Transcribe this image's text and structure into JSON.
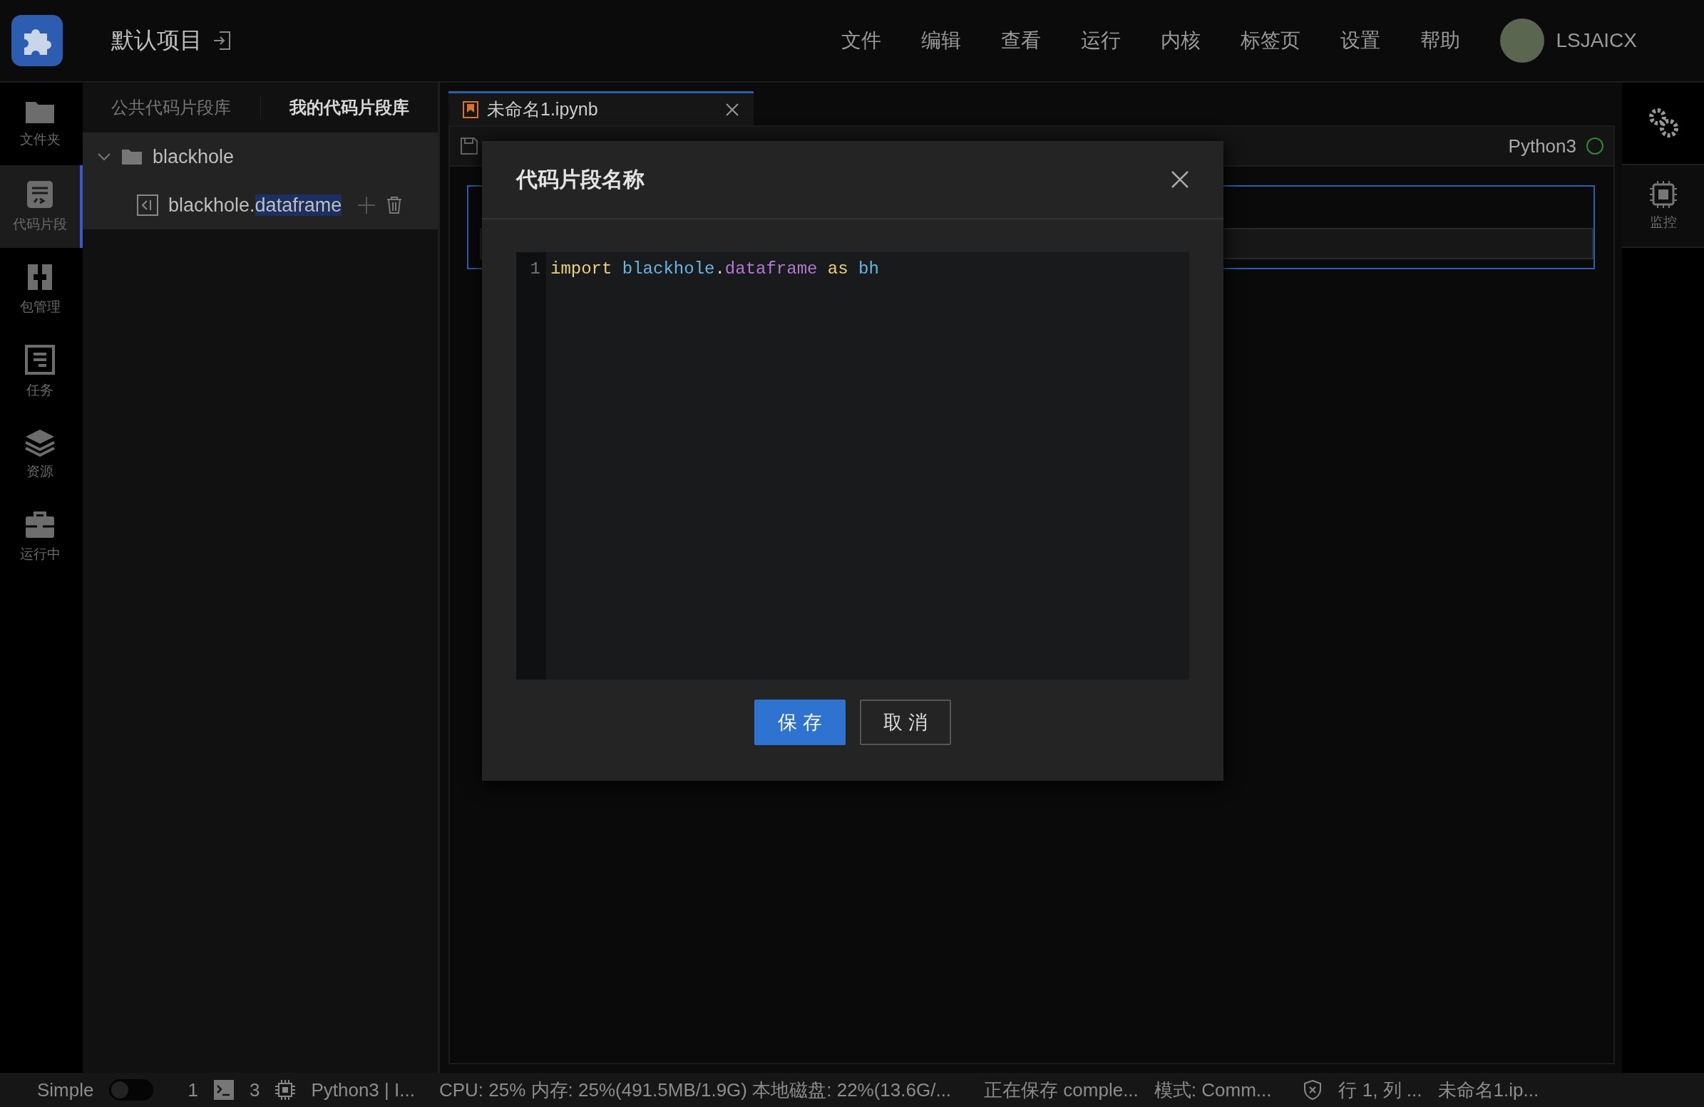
{
  "header": {
    "project": "默认项目",
    "menu": [
      "文件",
      "编辑",
      "查看",
      "运行",
      "内核",
      "标签页",
      "设置",
      "帮助"
    ],
    "user": "LSJAICX"
  },
  "sidebar": {
    "items": [
      {
        "label": "文件夹",
        "kind": "folder",
        "selected": false
      },
      {
        "label": "代码片段",
        "kind": "snippet",
        "selected": true
      },
      {
        "label": "包管理",
        "kind": "package",
        "selected": false
      },
      {
        "label": "任务",
        "kind": "task",
        "selected": false
      },
      {
        "label": "资源",
        "kind": "layers",
        "selected": false
      },
      {
        "label": "运行中",
        "kind": "briefcase",
        "selected": false
      }
    ]
  },
  "snippet_panel": {
    "tabs": [
      {
        "label": "公共代码片段库",
        "selected": false
      },
      {
        "label": "我的代码片段库",
        "selected": true
      }
    ],
    "tree": [
      {
        "label": "blackhole",
        "expanded": true,
        "children": [
          {
            "parts": [
              {
                "text": "blackhole.",
                "highlighted": false
              },
              {
                "text": "dataframe",
                "highlighted": true
              }
            ]
          }
        ]
      }
    ]
  },
  "editor": {
    "tabs": [
      {
        "label": "未命名1.ipynb",
        "selected": true
      }
    ],
    "kernel": "Python3"
  },
  "right_rail": {
    "items": [
      {
        "kind": "settings"
      },
      {
        "label": "监控",
        "kind": "monitor"
      }
    ]
  },
  "dialog": {
    "title": "代码片段名称",
    "line_number": "1",
    "code_words": [
      [
        {
          "text": "import",
          "kind": "keyword"
        }
      ],
      [
        {
          "text": "blackhole",
          "kind": "name"
        },
        {
          "text": ".",
          "kind": "plain"
        },
        {
          "text": "dataframe",
          "kind": "attr"
        }
      ],
      [
        {
          "text": "as",
          "kind": "keyword"
        }
      ],
      [
        {
          "text": "bh",
          "kind": "name"
        }
      ]
    ],
    "buttons": [
      {
        "label": "保 存",
        "kind": "primary"
      },
      {
        "label": "取 消",
        "kind": "secondary"
      }
    ]
  },
  "status_bar": {
    "mode": "Simple",
    "simple_on": false,
    "terminals": "1",
    "kernels": "3",
    "kernel": "Python3 | I...",
    "resources": "CPU:  25% 内存:  25%(491.5MB/1.9G) 本地磁盘:  22%(13.6G/...",
    "saving": "正在保存 comple...",
    "edit_mode": "模式:  Comm...",
    "position": "行 1, 列 ...",
    "file": "未命名1.ip..."
  }
}
